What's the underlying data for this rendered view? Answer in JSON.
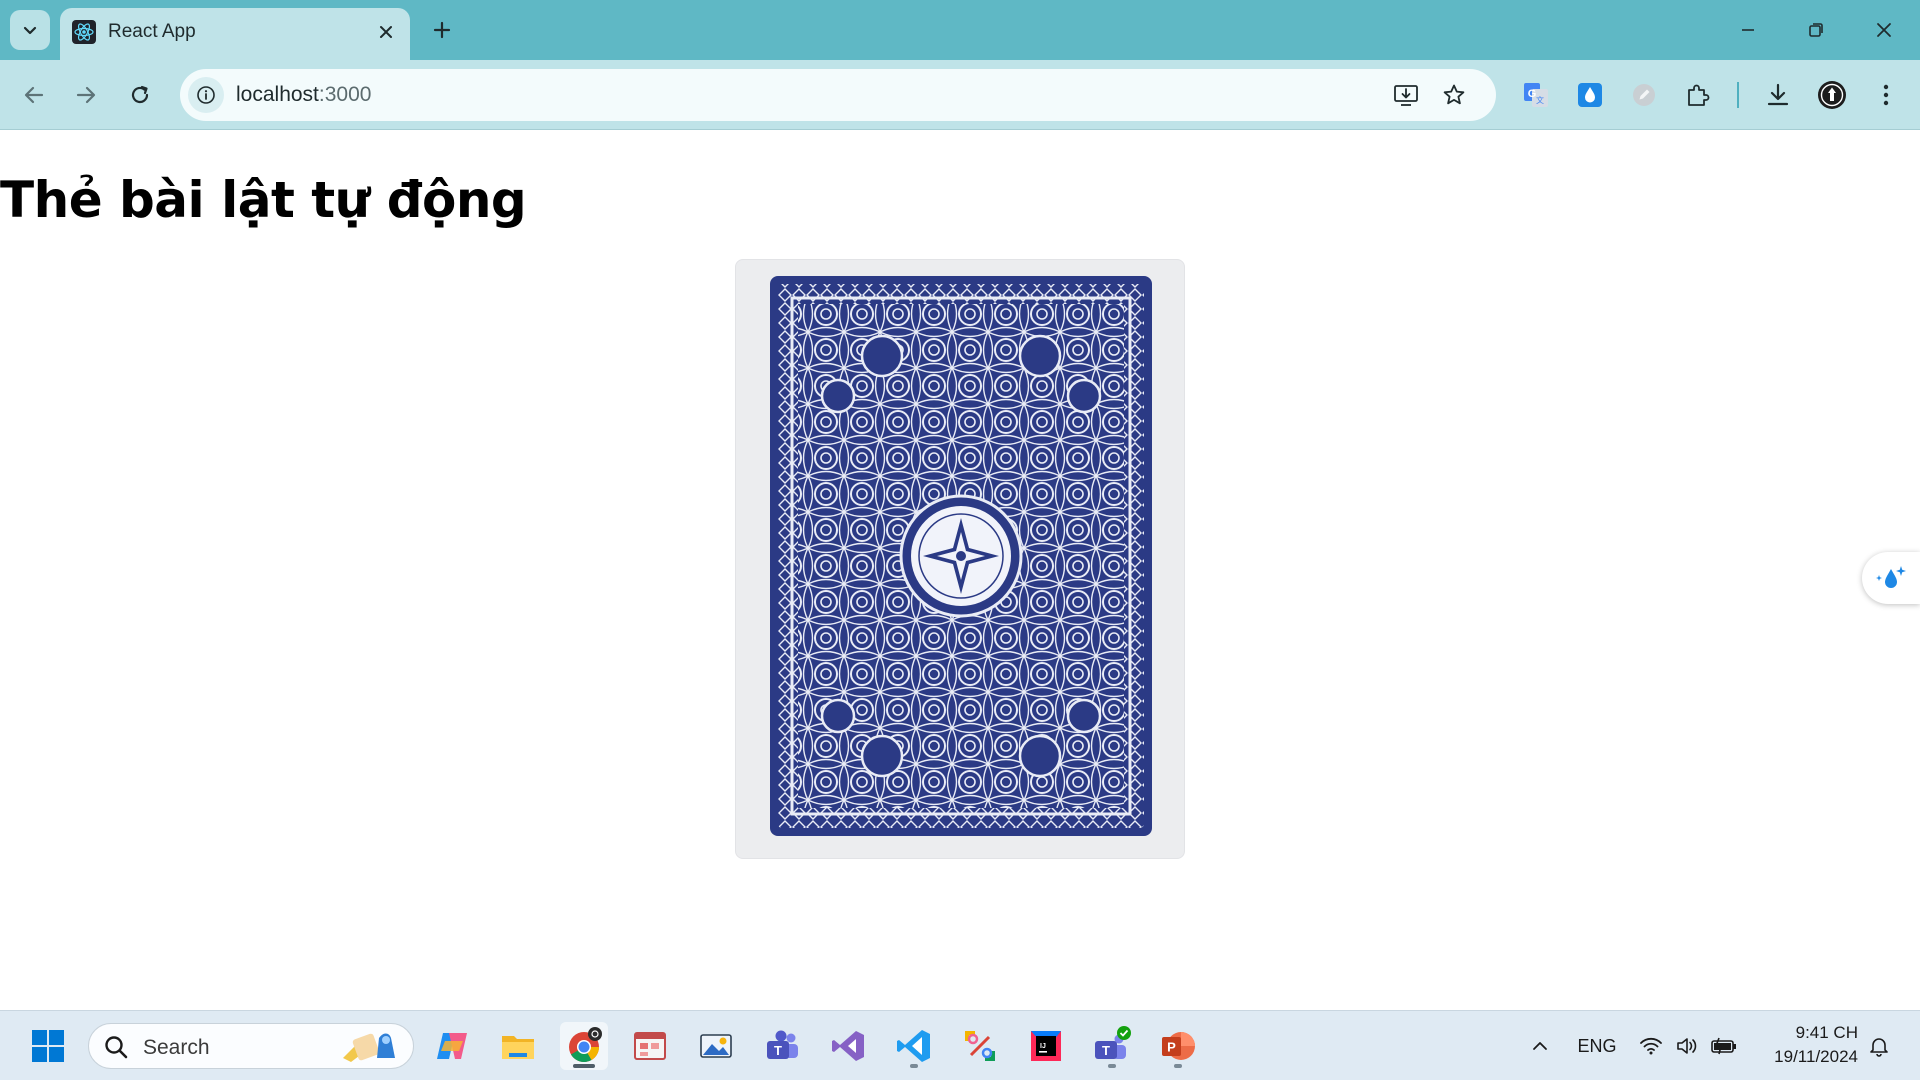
{
  "browser": {
    "tab": {
      "title": "React App",
      "favicon": "react-logo-icon"
    },
    "address_bar": {
      "host": "localhost",
      "port": ":3000"
    },
    "accent_color": "#5fb8c5",
    "toolbar_color": "#bfe3e8"
  },
  "page": {
    "title": "Thẻ bài lật tự động",
    "card": {
      "face": "back",
      "back_color": "#2b3a85"
    }
  },
  "taskbar": {
    "search_placeholder": "Search",
    "apps": [
      "windows-start-icon",
      "copilot-icon",
      "file-explorer-icon",
      "chrome-icon",
      "todo-app-icon",
      "photos-app-icon",
      "teams-icon",
      "visual-studio-icon",
      "vscode-icon",
      "snipping-tool-icon",
      "intellij-icon",
      "teams-work-icon",
      "powerpoint-icon"
    ],
    "tray": {
      "language": "ENG",
      "time": "9:41 CH",
      "date": "19/11/2024"
    }
  }
}
